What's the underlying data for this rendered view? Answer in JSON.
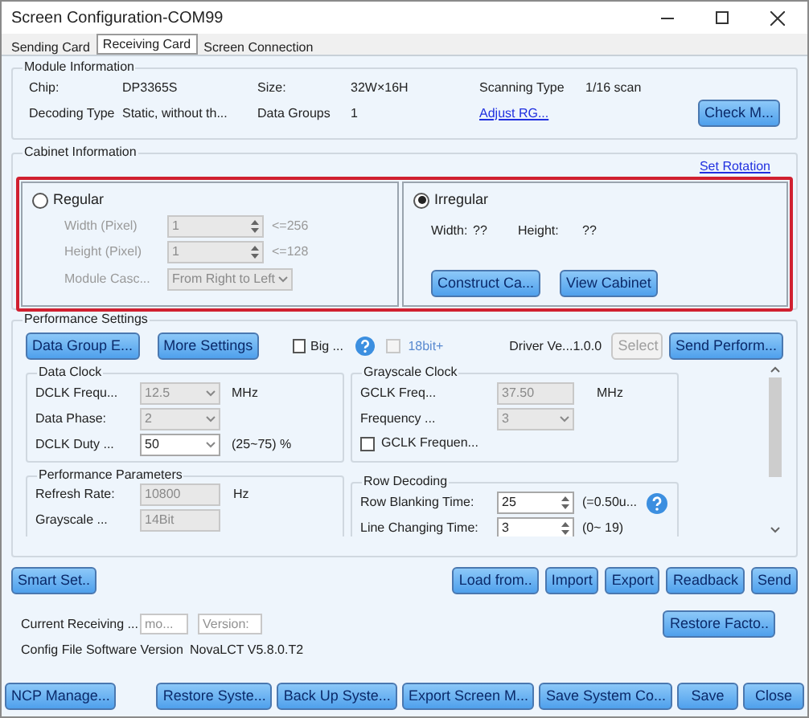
{
  "window": {
    "title": "Screen Configuration-COM99"
  },
  "tabs": [
    {
      "label": "Sending Card",
      "selected": false
    },
    {
      "label": "Receiving Card",
      "selected": true
    },
    {
      "label": "Screen Connection",
      "selected": false
    }
  ],
  "module_information": {
    "title": "Module Information",
    "fields": [
      {
        "label": "Chip:",
        "value": "DP3365S"
      },
      {
        "label": "Size:",
        "value": "32W×16H"
      },
      {
        "label": "Scanning Type",
        "value": "1/16 scan"
      },
      {
        "label": "Decoding Type",
        "value": "Static, without th..."
      },
      {
        "label": "Data Groups",
        "value": "1"
      }
    ],
    "link": "Adjust RG...",
    "button": "Check M..."
  },
  "cabinet_information": {
    "title": "Cabinet Information",
    "link": "Set Rotation",
    "regular": {
      "label": "Regular",
      "selected": false,
      "rows": [
        {
          "label": "Width (Pixel)",
          "value": "1",
          "hint": "<=256"
        },
        {
          "label": "Height (Pixel)",
          "value": "1",
          "hint": "<=128"
        }
      ],
      "cascade_label": "Module Casc...",
      "cascade_value": "From Right to Left"
    },
    "irregular": {
      "label": "Irregular",
      "selected": true,
      "width_label": "Width:",
      "width_value": "??",
      "height_label": "Height:",
      "height_value": "??",
      "buttons": [
        "Construct Ca...",
        "View Cabinet"
      ]
    }
  },
  "performance_settings": {
    "title": "Performance Settings",
    "buttons": [
      "Data Group E...",
      "More Settings"
    ],
    "big": {
      "label": "Big ...",
      "checked": false
    },
    "bit18": {
      "label": "18bit+",
      "checked": false,
      "disabled": true
    },
    "driver_label": "Driver Ve...",
    "driver_value": "1.0.0",
    "select_button": "Select",
    "send_button": "Send Perform...",
    "data_clock": {
      "title": "Data Clock",
      "rows": [
        {
          "label": "DCLK Frequ...",
          "value": "12.5",
          "unit": "MHz",
          "disabled": true
        },
        {
          "label": "Data Phase:",
          "value": "2",
          "disabled": true
        },
        {
          "label": "DCLK Duty ...",
          "value": "50",
          "unit": "(25~75) %",
          "disabled": false
        }
      ]
    },
    "grayscale_clock": {
      "title": "Grayscale Clock",
      "freq_label": "GCLK Freq...",
      "freq_value": "37.50",
      "freq_unit": "MHz",
      "mult_label": "Frequency ...",
      "mult_value": "3",
      "check": {
        "label": "GCLK Frequen...",
        "checked": false
      }
    },
    "performance_parameters": {
      "title": "Performance Parameters",
      "rows": [
        {
          "label": "Refresh Rate:",
          "value": "10800",
          "unit": "Hz"
        },
        {
          "label": "Grayscale ...",
          "value": "14Bit"
        }
      ]
    },
    "row_decoding": {
      "title": "Row Decoding",
      "rows": [
        {
          "label": "Row Blanking Time:",
          "value": "25",
          "hint": "(=0.50u..."
        },
        {
          "label": "Line Changing Time:",
          "value": "3",
          "hint": "(0~ 19)"
        }
      ]
    }
  },
  "action_buttons": {
    "left": "Smart Set..",
    "right": [
      "Load from..",
      "Import",
      "Export",
      "Readback",
      "Send"
    ]
  },
  "receiving": {
    "label": "Current Receiving ...",
    "model_placeholder": "mo...",
    "version_placeholder": "Version:",
    "restore_button": "Restore Facto..",
    "config_label": "Config File Software Version",
    "config_value": "NovaLCT V5.8.0.T2"
  },
  "footer": {
    "left": "NCP Manage...",
    "right": [
      "Restore Syste...",
      "Back Up Syste...",
      "Export Screen M...",
      "Save System Co...",
      "Save",
      "Close"
    ]
  }
}
